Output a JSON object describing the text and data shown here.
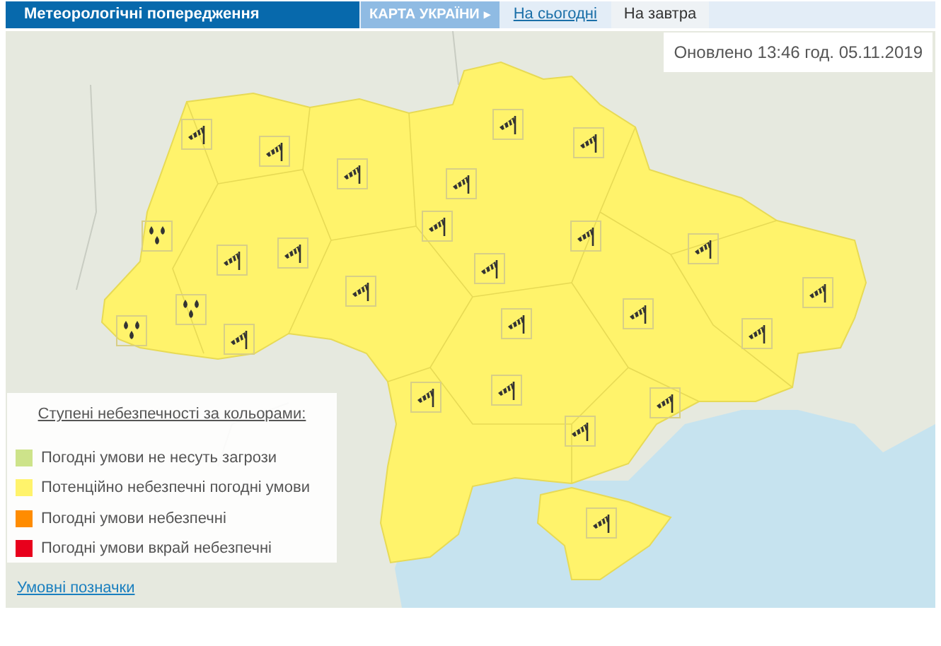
{
  "header": {
    "title": "Метеорологічні попередження"
  },
  "tabs": [
    {
      "label": "КАРТА УКРАЇНИ",
      "arrow": "▸",
      "kind": "section"
    },
    {
      "label": "На сьогодні",
      "kind": "day",
      "selected": false
    },
    {
      "label": "На завтра",
      "kind": "day",
      "selected": true
    }
  ],
  "updated": "Оновлено 13:46 год. 05.11.2019",
  "map": {
    "markers": [
      {
        "kind": "wind"
      },
      {
        "kind": "wind"
      },
      {
        "kind": "wind"
      },
      {
        "kind": "wind"
      },
      {
        "kind": "wind"
      },
      {
        "kind": "wind"
      },
      {
        "kind": "wind"
      },
      {
        "kind": "rain"
      },
      {
        "kind": "wind"
      },
      {
        "kind": "wind"
      },
      {
        "kind": "wind"
      },
      {
        "kind": "wind"
      },
      {
        "kind": "wind"
      },
      {
        "kind": "wind"
      },
      {
        "kind": "rain"
      },
      {
        "kind": "rain"
      },
      {
        "kind": "wind"
      },
      {
        "kind": "wind"
      },
      {
        "kind": "wind"
      },
      {
        "kind": "wind"
      },
      {
        "kind": "wind"
      },
      {
        "kind": "wind"
      },
      {
        "kind": "wind"
      },
      {
        "kind": "wind"
      },
      {
        "kind": "wind"
      },
      {
        "kind": "wind"
      }
    ]
  },
  "legend": {
    "title": "Ступені небезпечності за кольорами:",
    "items": [
      {
        "label": "Погодні умови не несуть загрози",
        "color": "#cde38a"
      },
      {
        "label": "Потенційно небезпечні погодні умови",
        "color": "#fff36b"
      },
      {
        "label": "Погодні умови небезпечні",
        "color": "#ff8c00"
      },
      {
        "label": "Погодні умови вкрай небезпечні",
        "color": "#e8001c"
      }
    ]
  },
  "legend_link": "Умовні позначки"
}
